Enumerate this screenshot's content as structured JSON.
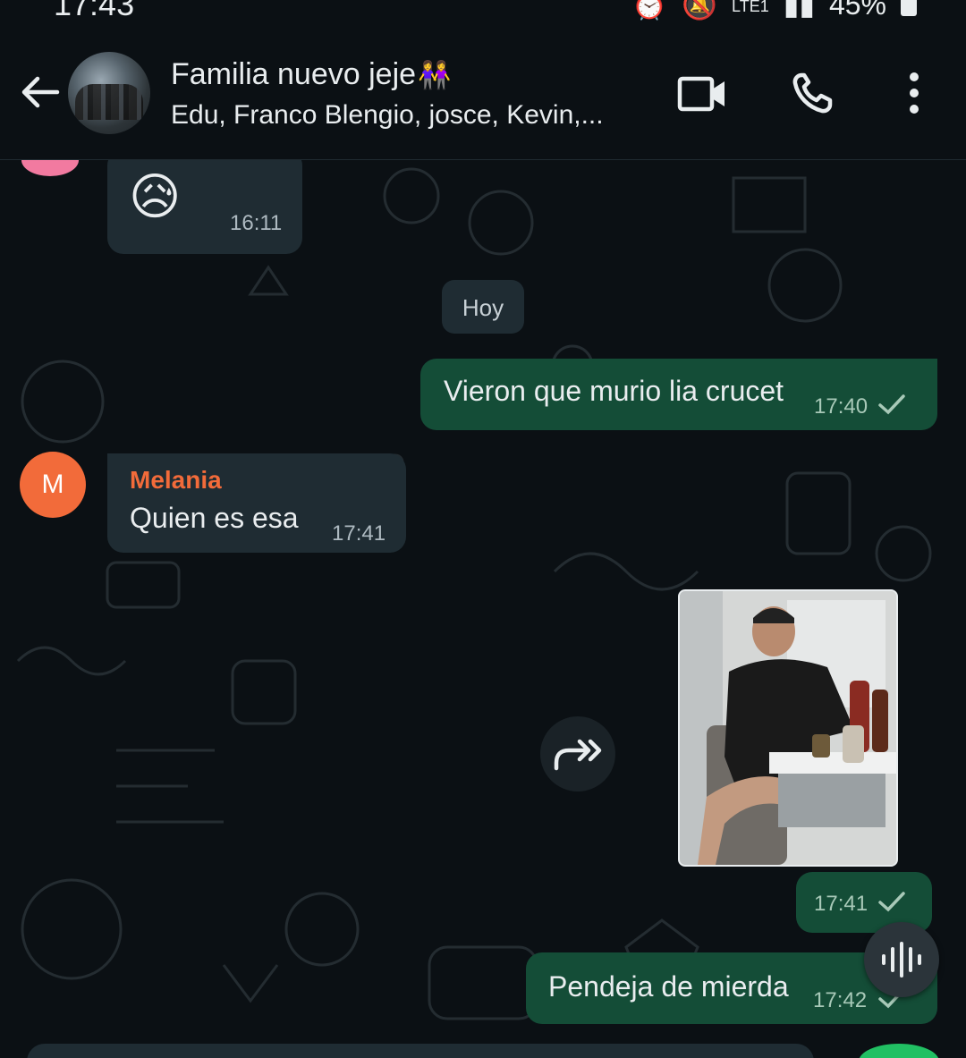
{
  "status_bar": {
    "time": "17:43",
    "network": "LTE1",
    "battery": "45%"
  },
  "header": {
    "back_icon": "arrow-left-icon",
    "title": "Familia nuevo jeje",
    "title_emoji": "👭",
    "subtitle": "Edu, Franco Blengio, josce, Kevin,...",
    "actions": [
      "video-call-icon",
      "voice-call-icon",
      "more-vertical-icon"
    ]
  },
  "messages": [
    {
      "direction": "incoming",
      "content": "😥",
      "time": "16:11"
    },
    {
      "type": "date_divider",
      "label": "Hoy"
    },
    {
      "direction": "outgoing",
      "text": "Vieron que murio lia crucet",
      "time": "17:40",
      "status": "sent"
    },
    {
      "direction": "incoming",
      "sender": "Melania",
      "sender_initial": "M",
      "text": "Quien es esa",
      "time": "17:41"
    },
    {
      "direction": "outgoing",
      "type": "image",
      "description": "photo",
      "time": "17:41",
      "status": "sent"
    },
    {
      "direction": "outgoing",
      "text": "Pendeja de mierda",
      "time": "17:42",
      "status": "sent"
    }
  ],
  "colors": {
    "background": "#0b1014",
    "incoming_bubble": "#1f2c33",
    "outgoing_bubble": "#144d37",
    "sender_accent": "#f26b3a",
    "text": "#e9edef"
  }
}
